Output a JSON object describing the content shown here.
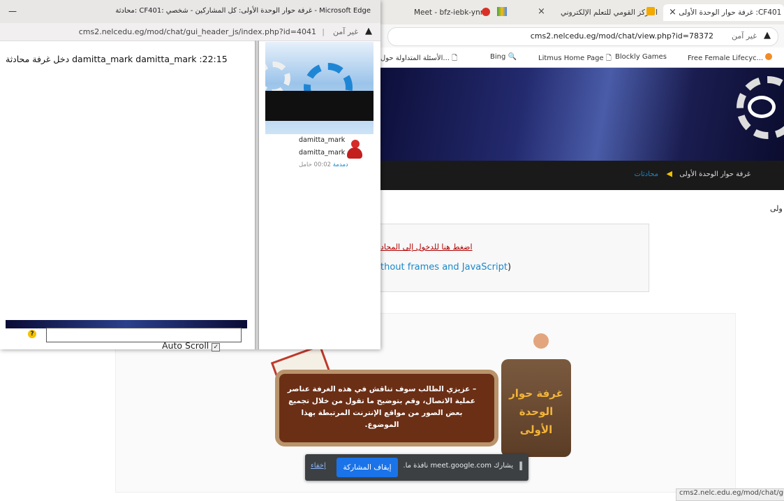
{
  "background_window": {
    "tabs": [
      {
        "label": "غرفة حوار الوحدة الأولى :CF401"
      },
      {
        "label": "المركز القومي للتعلم الإلكتروني"
      },
      {
        "label": "Meet - bfz-iebk-ynm"
      }
    ],
    "close_glyph": "×",
    "address": {
      "security": "غير آمن",
      "url": "cms2.nelcedu.eg/mod/chat/view.php?id=78372"
    },
    "favorites": [
      "Bing",
      "Litmus Home Page",
      "Blockly Games",
      "Free Female Lifecyc...",
      "الأسئلة المتداولة حول..."
    ],
    "breadcrumb": {
      "current": "غرفة حوار الوحدة الأولى",
      "parent": "محادثات"
    },
    "page_heading_fragment": "ولى",
    "enter_chat_link": "اضغط هنا للدخول إلى المحاد",
    "no_frames_link": "thout frames and JavaScript",
    "no_frames_suffix": ")",
    "promo": {
      "badge": "غرفة حوار الوحدة الأولى",
      "text": "– عزيزي الطالب سوف تناقش في هذه الغرفة عناصر عملية الاتصال، وقم بتوضيح ما تقول من خلال تجميع بعض الصور من مواقع الإنترنت المرتبطة بهذا الموضوع."
    },
    "status_url": "cms2.nelc.edu.eg/mod/chat/gu"
  },
  "popup": {
    "title": "محادثة: CF401: غرفة حوار الوحدة الأولى: كل المشاركين - شخصي - Microsoft Edge",
    "minimize_glyph": "—",
    "address": {
      "security": "غير آمن",
      "url": "cms2.nelcedu.eg/mod/chat/gui_header_js/index.php?id=4041"
    },
    "messages": [
      {
        "text": "22:15: damitta_mark damitta_mark دخل غرفة محادثة"
      }
    ],
    "users": [
      {
        "first": "damitta_mark",
        "last": "damitta_mark",
        "idle_label": "خامل",
        "idle_time": "00:02",
        "beep": "دمدمة"
      }
    ],
    "auto_scroll_label": "Auto Scroll",
    "auto_scroll_checked": true
  },
  "share_bar": {
    "text": "يشارك meet.google.com نافذة ما.",
    "stop_label": "إيقاف المشاركة",
    "hide_label": "إخفاء"
  },
  "colors": {
    "link": "#1a88c9",
    "enter_link": "#b00000",
    "share_blue": "#1a73e8"
  }
}
